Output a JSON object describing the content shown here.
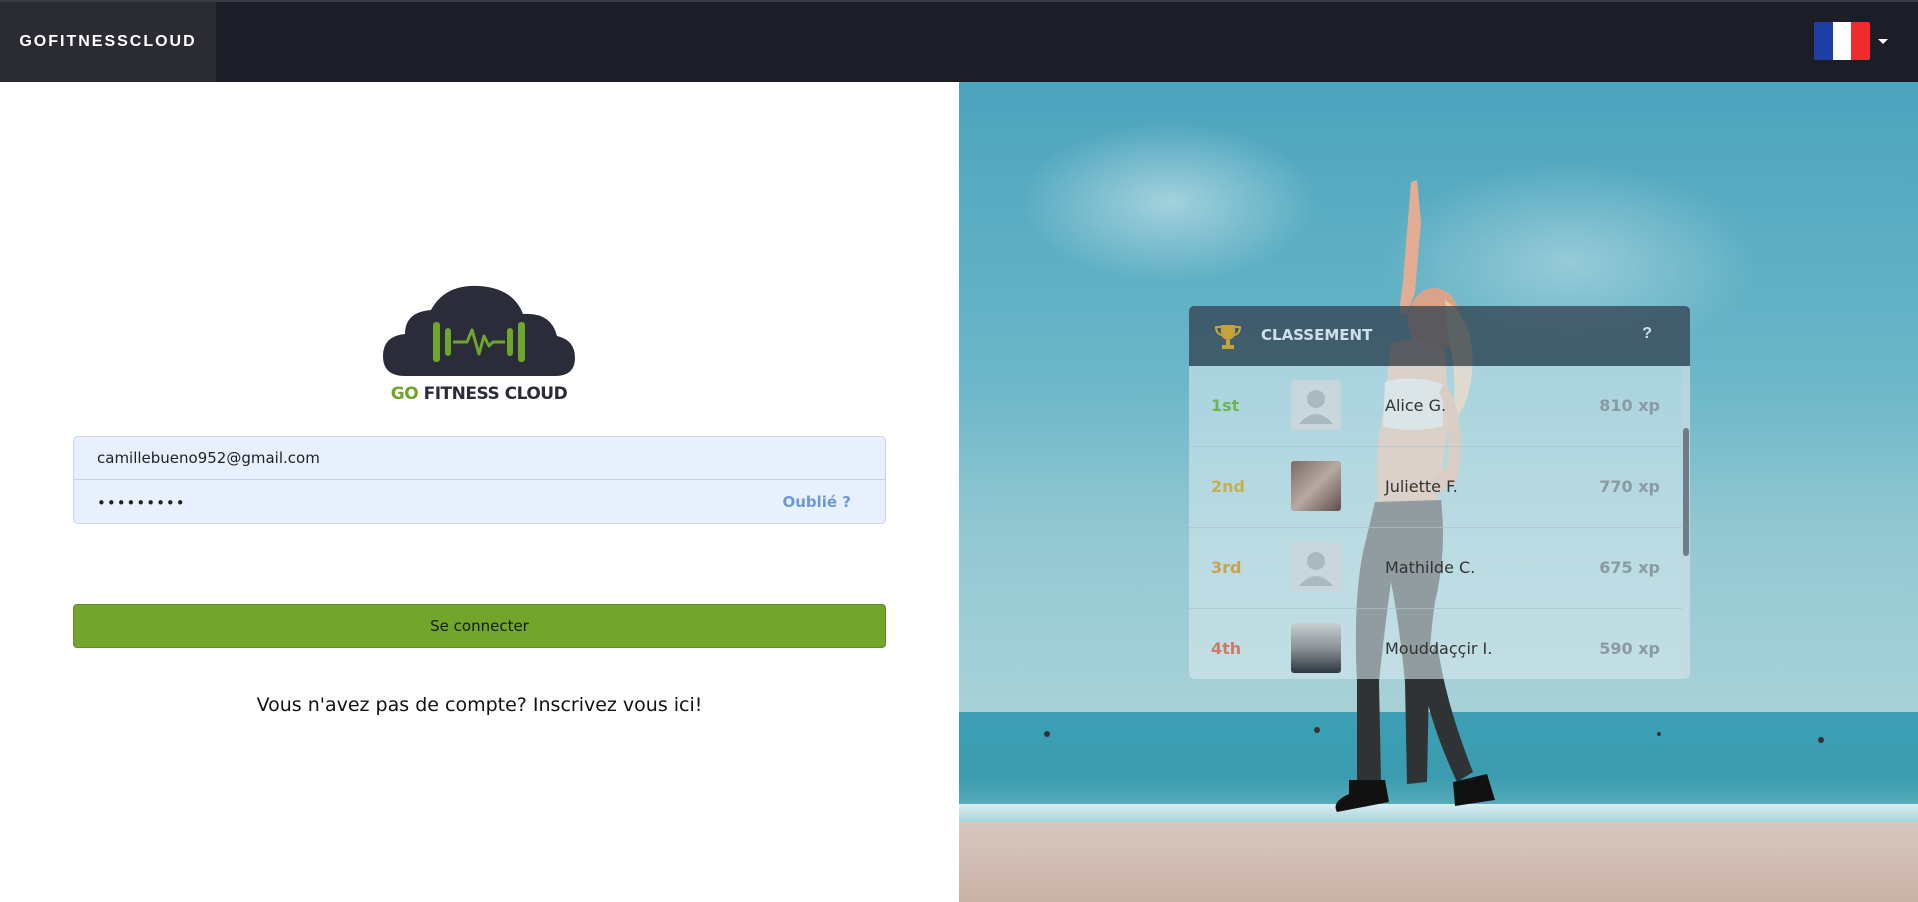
{
  "navbar": {
    "brand": "GOFITNESSCLOUD",
    "language": {
      "flag_icon": "flag-france-icon",
      "colors": [
        "#1f3fa6",
        "#ffffff",
        "#ef2b2d"
      ]
    }
  },
  "logo": {
    "go": "GO",
    "rest": "FITNESS CLOUD",
    "colors": {
      "cloud": "#2a2c3a",
      "accent": "#6fa52d"
    }
  },
  "login": {
    "email_value": "camillebueno952@gmail.com",
    "password_value": "•••••••••",
    "forgot_label": "Oublié ?",
    "submit_label": "Se connecter",
    "signup_text": "Vous n'avez pas de compte? Inscrivez vous ici!"
  },
  "leaderboard": {
    "title": "CLASSEMENT",
    "help": "?",
    "rows": [
      {
        "rank": "1st",
        "name": "Alice G.",
        "xp": "810 xp",
        "rank_color": "#6fb54e",
        "avatar": "default-avatar-icon"
      },
      {
        "rank": "2nd",
        "name": "Juliette F.",
        "xp": "770 xp",
        "rank_color": "#c5b14a",
        "avatar": "user-photo"
      },
      {
        "rank": "3rd",
        "name": "Mathilde C.",
        "xp": "675 xp",
        "rank_color": "#c9a24b",
        "avatar": "default-avatar-icon"
      },
      {
        "rank": "4th",
        "name": "Mouddaççir I.",
        "xp": "590 xp",
        "rank_color": "#cf7b63",
        "avatar": "user-photo"
      }
    ]
  },
  "colors": {
    "navbar": "#1c1d26",
    "primary_button": "#71a52b",
    "input_bg": "#e8f0fe"
  }
}
